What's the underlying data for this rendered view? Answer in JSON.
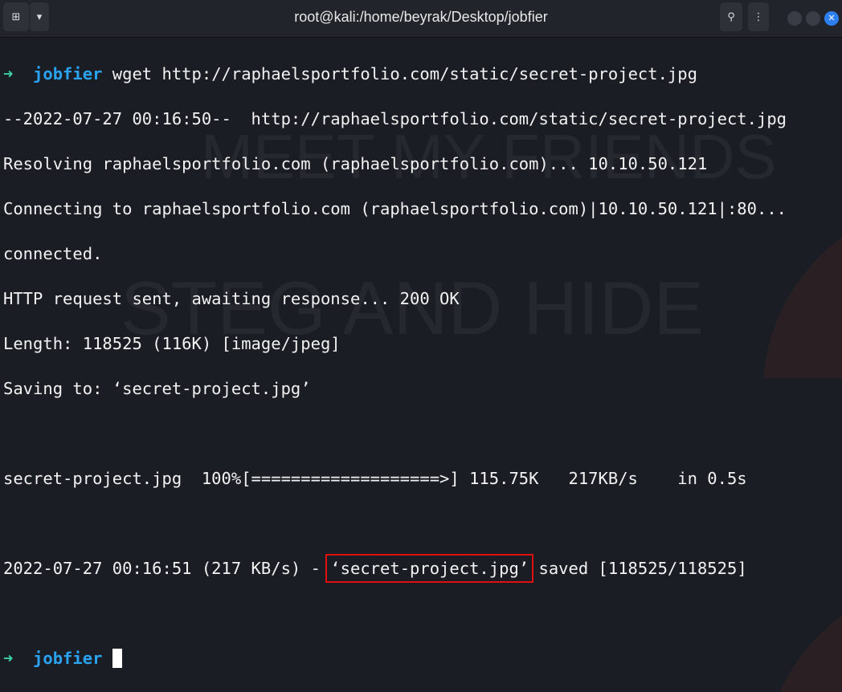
{
  "window": {
    "title": "root@kali:/home/beyrak/Desktop/jobfier"
  },
  "watermark": {
    "line1": "MEET MY FRIENDS",
    "line2": "STEG AND HIDE"
  },
  "prompt": {
    "dir": "jobfier"
  },
  "lines": [
    {
      "cmd": "wget http://raphaelsportfolio.com/static/secret-project.jpg"
    },
    "--2022-07-27 00:16:50--  http://raphaelsportfolio.com/static/secret-project.jpg",
    "Resolving raphaelsportfolio.com (raphaelsportfolio.com)... 10.10.50.121",
    "Connecting to raphaelsportfolio.com (raphaelsportfolio.com)|10.10.50.121|:80...",
    "connected.",
    "HTTP request sent, awaiting response... 200 OK",
    "Length: 118525 (116K) [image/jpeg]",
    "Saving to: ‘secret-project.jpg’",
    "secret-project.jpg  100%[===================>] 115.75K   217KB/s    in 0.5s"
  ],
  "saved": {
    "prefix": "2022-07-27 00:16:51 (217 KB/s) - ",
    "file": "‘secret-project.jpg’",
    "suffix": " saved [118525/118525]"
  }
}
